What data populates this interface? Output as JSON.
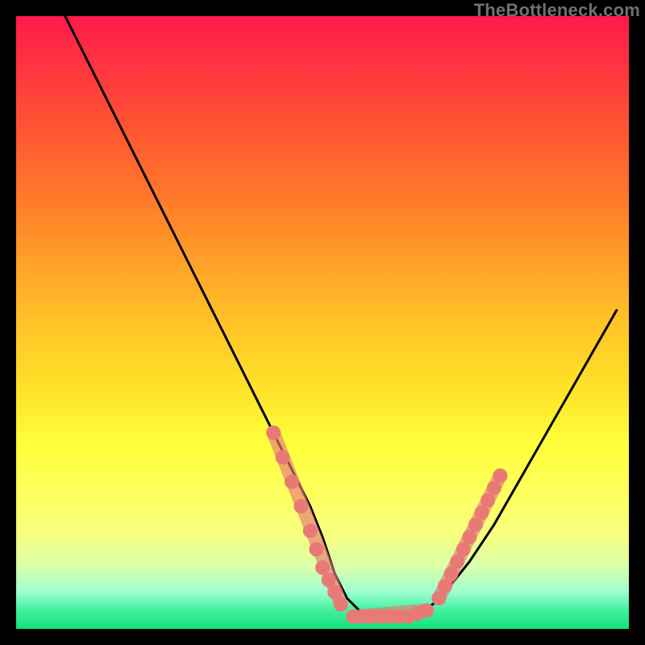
{
  "watermark": "TheBottleneck.com",
  "colors": {
    "frame": "#000000",
    "curve_stroke": "#000000",
    "marker_fill": "#e87a76",
    "marker_stroke": "#e87a76"
  },
  "chart_data": {
    "type": "line",
    "title": "",
    "xlabel": "",
    "ylabel": "",
    "xlim": [
      0,
      100
    ],
    "ylim": [
      0,
      100
    ],
    "series": [
      {
        "name": "curve",
        "x": [
          8,
          12,
          16,
          20,
          24,
          28,
          32,
          36,
          40,
          44,
          48,
          50,
          52,
          54,
          56,
          58,
          60,
          62,
          64,
          66,
          68,
          70,
          74,
          78,
          82,
          86,
          90,
          94,
          98
        ],
        "values": [
          100,
          92,
          84,
          76,
          68,
          60,
          52,
          44,
          36,
          28,
          20,
          15,
          9,
          5,
          3,
          2,
          2,
          2,
          2,
          3,
          4,
          6,
          11,
          17,
          24,
          31,
          38,
          45,
          52
        ]
      }
    ],
    "markers": {
      "left_group": [
        {
          "x": 42,
          "y": 32
        },
        {
          "x": 43.5,
          "y": 28
        },
        {
          "x": 45,
          "y": 24
        },
        {
          "x": 46.5,
          "y": 20
        },
        {
          "x": 48,
          "y": 16
        },
        {
          "x": 49,
          "y": 13
        },
        {
          "x": 50,
          "y": 10
        },
        {
          "x": 51,
          "y": 8
        },
        {
          "x": 52,
          "y": 6
        },
        {
          "x": 53,
          "y": 4
        }
      ],
      "valley_group": [
        {
          "x": 55,
          "y": 2
        },
        {
          "x": 56.5,
          "y": 2
        },
        {
          "x": 58,
          "y": 2
        },
        {
          "x": 59.5,
          "y": 2
        },
        {
          "x": 61,
          "y": 2
        },
        {
          "x": 62.5,
          "y": 2
        },
        {
          "x": 64,
          "y": 2
        },
        {
          "x": 65.5,
          "y": 2.5
        },
        {
          "x": 67,
          "y": 3
        }
      ],
      "right_group": [
        {
          "x": 69,
          "y": 5
        },
        {
          "x": 70,
          "y": 7
        },
        {
          "x": 71,
          "y": 9
        },
        {
          "x": 72,
          "y": 11
        },
        {
          "x": 73,
          "y": 13
        },
        {
          "x": 74,
          "y": 15
        },
        {
          "x": 75,
          "y": 17
        },
        {
          "x": 76,
          "y": 19
        },
        {
          "x": 77,
          "y": 21
        },
        {
          "x": 78,
          "y": 23
        },
        {
          "x": 79,
          "y": 25
        }
      ]
    }
  }
}
